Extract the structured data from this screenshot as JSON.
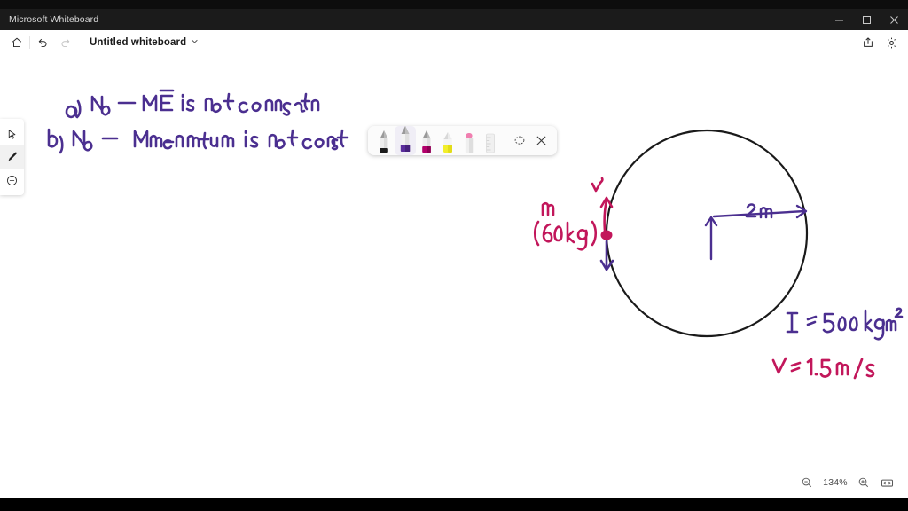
{
  "window": {
    "app_title": "Microsoft Whiteboard",
    "controls": [
      {
        "name": "minimize",
        "label": "Minimize"
      },
      {
        "name": "maximize",
        "label": "Restore"
      },
      {
        "name": "close",
        "label": "Close"
      }
    ]
  },
  "appbar": {
    "home_label": "Home",
    "undo_label": "Undo",
    "redo_label": "Redo",
    "doc_title": "Untitled whiteboard",
    "doc_chevron": "⌄",
    "share_label": "Share",
    "settings_label": "Settings"
  },
  "rail": {
    "items": [
      {
        "name": "select-tool",
        "label": "Select",
        "active": false
      },
      {
        "name": "pen-tool",
        "label": "Inking",
        "active": true
      },
      {
        "name": "insert-tool",
        "label": "Create",
        "active": false
      }
    ]
  },
  "pen_toolbar": {
    "pens": [
      {
        "name": "black-pen",
        "label": "Ballpoint pen black",
        "color": "#1b1b1b",
        "selected": false
      },
      {
        "name": "purple-pen",
        "label": "Ballpoint pen purple",
        "color": "#5a2d9b",
        "selected": true
      },
      {
        "name": "magenta-pen",
        "label": "Ballpoint pen magenta",
        "color": "#b3006b",
        "selected": false
      },
      {
        "name": "yellow-highlighter",
        "label": "Highlighter yellow",
        "color": "#f2ee2a",
        "selected": false
      },
      {
        "name": "eraser",
        "label": "Eraser",
        "color": "#f07fb0",
        "selected": false
      },
      {
        "name": "ruler",
        "label": "Ruler",
        "color": "#d6d6d6",
        "selected": false
      }
    ],
    "lasso_label": "Lasso select",
    "close_label": "Close ink toolbar"
  },
  "zoom": {
    "zoom_out_label": "Zoom out",
    "level": "134%",
    "zoom_in_label": "Zoom in",
    "fit_label": "Fit to screen"
  },
  "ink_colors": {
    "purple": "#4b2f90",
    "magenta": "#c2175b",
    "black": "#1a1a1a"
  },
  "canvas": {
    "notes": [
      {
        "name": "answer-line-a",
        "text": "a) No — ME is not constant"
      },
      {
        "name": "answer-line-b",
        "text": "b) No — Momentum is not const"
      }
    ],
    "diagram": {
      "name": "rotating-disk-diagram",
      "circle_label": "disk outline",
      "mass_label_line1": "m",
      "mass_label_line2": "(60kg)",
      "velocity_label": "v",
      "radius_label": "2m",
      "inertia_label": "I = 500 kg m²",
      "speed_label": "v = 1.5 m/s"
    }
  }
}
